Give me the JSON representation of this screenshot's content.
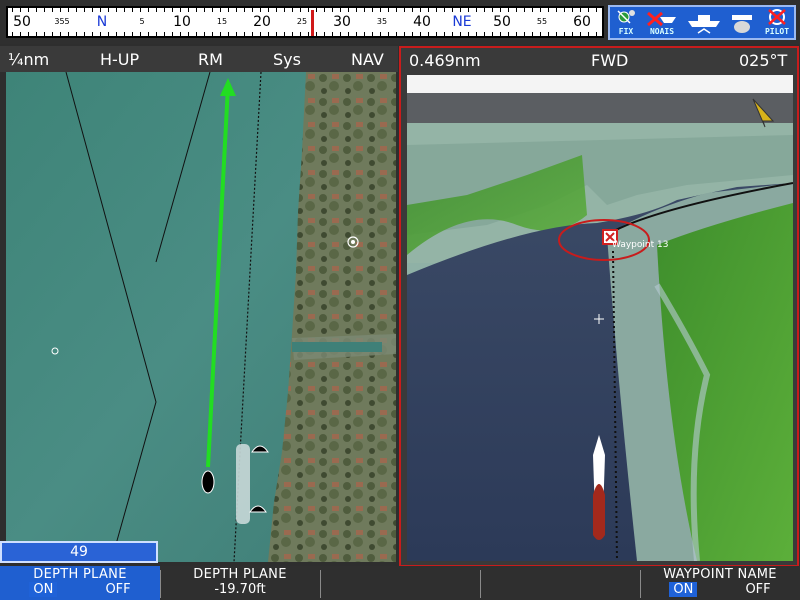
{
  "compass": {
    "labels": [
      {
        "text": "50",
        "small": false
      },
      {
        "text": "355",
        "small": true
      },
      {
        "text": "N",
        "small": false,
        "cardinal": true
      },
      {
        "text": "5",
        "small": true
      },
      {
        "text": "10",
        "small": false
      },
      {
        "text": "15",
        "small": true
      },
      {
        "text": "20",
        "small": false
      },
      {
        "text": "25",
        "small": true
      },
      {
        "text": "30",
        "small": false
      },
      {
        "text": "35",
        "small": true
      },
      {
        "text": "40",
        "small": false
      },
      {
        "text": "NE",
        "small": false,
        "cardinal": true
      },
      {
        "text": "50",
        "small": false
      },
      {
        "text": "55",
        "small": true
      },
      {
        "text": "60",
        "small": false
      }
    ]
  },
  "toolbar": {
    "fix": "FIX",
    "noais": "NOAIS",
    "pilot": "PILOT"
  },
  "left_pane": {
    "range": "¼nm",
    "orientation": "H-UP",
    "motion": "RM",
    "sys": "Sys",
    "nav": "NAV",
    "scale_value": "49"
  },
  "right_pane": {
    "range": "0.469nm",
    "view": "FWD",
    "heading": "025°T",
    "waypoint_label": "Waypoint 13"
  },
  "softkeys": {
    "depth_plane_title": "DEPTH PLANE",
    "depth_plane_on": "ON",
    "depth_plane_off": "OFF",
    "depth_value_title": "DEPTH PLANE",
    "depth_value": "-19.70ft",
    "waypoint_name_title": "WAYPOINT NAME",
    "waypoint_name_on": "ON",
    "waypoint_name_off": "OFF"
  },
  "colors": {
    "accent": "#1f5fd0",
    "frame_red": "#c81c1c",
    "course_green": "#22dd22"
  }
}
